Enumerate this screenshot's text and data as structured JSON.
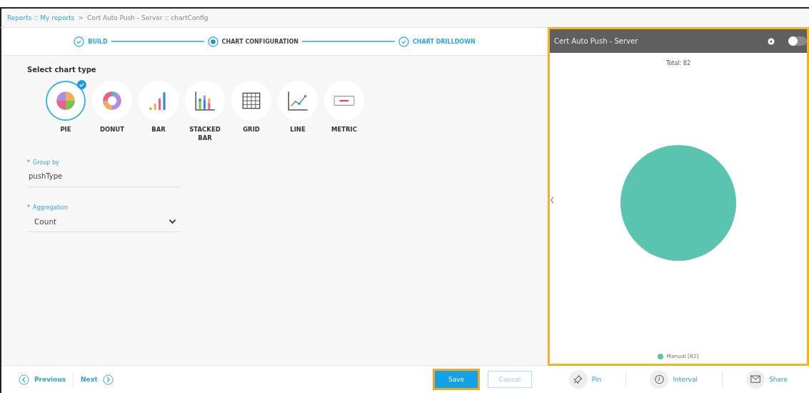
{
  "breadcrumb": {
    "links": [
      "Reports :: My reports"
    ],
    "separator": ">",
    "current": "Cert Auto Push - Server :: chartConfig"
  },
  "steps": [
    {
      "label": "BUILD",
      "selected": false
    },
    {
      "label": "CHART CONFIGURATION",
      "selected": true
    },
    {
      "label": "CHART DRILLDOWN",
      "selected": false
    }
  ],
  "section_title": "Select chart type",
  "chart_types": [
    {
      "kind": "pie",
      "label": "PIE",
      "selected": true
    },
    {
      "kind": "donut",
      "label": "DONUT",
      "selected": false
    },
    {
      "kind": "bar",
      "label": "BAR",
      "selected": false
    },
    {
      "kind": "stacked",
      "label": "STACKED BAR",
      "selected": false
    },
    {
      "kind": "grid",
      "label": "GRID",
      "selected": false
    },
    {
      "kind": "line",
      "label": "LINE",
      "selected": false
    },
    {
      "kind": "metric",
      "label": "METRIC",
      "selected": false
    }
  ],
  "fields": [
    {
      "kind": "text",
      "required_mark": "*",
      "label": "Group by",
      "value": "pushType"
    },
    {
      "kind": "select",
      "required_mark": "*",
      "label": "Aggregation",
      "value": "Count"
    }
  ],
  "footer": {
    "previous": "Previous",
    "next": "Next",
    "save": "Save",
    "cancel": "Cancel"
  },
  "preview": {
    "title": "Cert Auto Push - Server",
    "toggle_on": false,
    "total": "Total: 82",
    "legend": [
      {
        "label": "Manual [82]",
        "color": "#5bc4b0"
      }
    ]
  },
  "actions": [
    {
      "kind": "pin",
      "label": "Pin"
    },
    {
      "kind": "interval",
      "label": "Interval"
    },
    {
      "kind": "share",
      "label": "Share"
    }
  ]
}
